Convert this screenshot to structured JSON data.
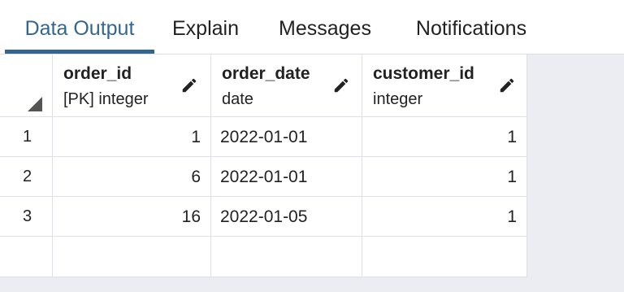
{
  "tabs": [
    {
      "label": "Data Output",
      "active": true
    },
    {
      "label": "Explain",
      "active": false
    },
    {
      "label": "Messages",
      "active": false
    },
    {
      "label": "Notifications",
      "active": false
    }
  ],
  "columns": [
    {
      "name": "order_id",
      "type": "[PK] integer"
    },
    {
      "name": "order_date",
      "type": "date"
    },
    {
      "name": "customer_id",
      "type": "integer"
    }
  ],
  "rows": [
    {
      "num": "1",
      "order_id": "1",
      "order_date": "2022-01-01",
      "customer_id": "1"
    },
    {
      "num": "2",
      "order_id": "6",
      "order_date": "2022-01-01",
      "customer_id": "1"
    },
    {
      "num": "3",
      "order_id": "16",
      "order_date": "2022-01-05",
      "customer_id": "1"
    }
  ],
  "icons": {
    "edit": "pencil-icon",
    "corner": "select-all-triangle-icon"
  },
  "colors": {
    "accent": "#326690",
    "border": "#dde0e6",
    "background": "#ebedf2"
  }
}
